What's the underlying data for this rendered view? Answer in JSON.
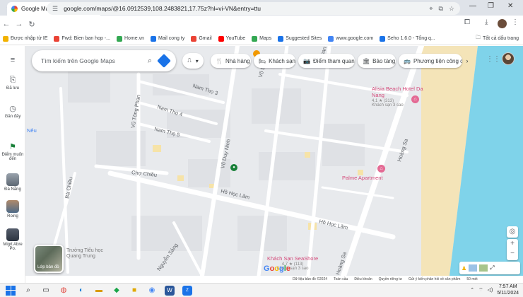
{
  "browser": {
    "tab_title": "Google Maps",
    "url": "google.com/maps/@16.0912539,108.2483821,17.75z?hl=vi-VN&entry=ttu",
    "bookmarks": [
      {
        "label": "Được nhập từ IE",
        "color": "#f2b200"
      },
      {
        "label": "Fwd: Bien ban hop -...",
        "color": "#ea4335"
      },
      {
        "label": "Home.vn",
        "color": "#34a853"
      },
      {
        "label": "Mail cong ty",
        "color": "#1a73e8"
      },
      {
        "label": "Gmail",
        "color": "#ea4335"
      },
      {
        "label": "YouTube",
        "color": "#ff0000"
      },
      {
        "label": "Maps",
        "color": "#34a853"
      },
      {
        "label": "Suggested Sites",
        "color": "#1a73e8"
      },
      {
        "label": "www.google.com",
        "color": "#4285f4"
      },
      {
        "label": "Seho 1.6.0 - Tổng q...",
        "color": "#1a73e8"
      }
    ],
    "all_bookmarks": "Tất cả dấu trang"
  },
  "rail": {
    "saved": "Đã lưu",
    "recent": "Gần đây",
    "want_to_go": "Điểm muốn đến",
    "place1": "Đà Nẵng",
    "place2": "Roing",
    "place3": "Migrt Abre Po."
  },
  "search": {
    "placeholder": "Tìm kiếm trên Google Maps"
  },
  "chips": [
    {
      "icon": "🍴",
      "label": "Nhà hàng"
    },
    {
      "icon": "🛏",
      "label": "Khách sạn"
    },
    {
      "icon": "📷",
      "label": "Điểm tham quan"
    },
    {
      "icon": "🏛",
      "label": "Bảo tàng"
    },
    {
      "icon": "🚌",
      "label": "Phương tiện công cộng"
    }
  ],
  "map": {
    "streets": {
      "nam_tho_3": "Nam Thọ 3",
      "nam_tho_4": "Nam Thọ 4",
      "nam_tho_5": "Nam Thọ 5",
      "vu_tong_phan": "Vũ Tông Phan",
      "vo_duy_ninh": "Võ Duy Ninh",
      "cho_chieu": "Chợ Chiều",
      "ho_hoc_lam": "Hồ Học Lãm",
      "ho_hoc_lam_2": "Hồ Học Lãm",
      "hoang_sa": "Hoàng Sa",
      "hoang_sa_2": "Hoàng Sa",
      "nguyen_sang": "Nguyễn Sáng",
      "phan": "Phan",
      "neu": "Nêu",
      "ba_chieu": "Bà Chiều",
      "vo_duy": "Võ Duy"
    },
    "pois": {
      "alisia_name": "Alisia Beach Hotel Da Nang",
      "alisia_rating": "4.1 ★ (313)",
      "alisia_sub": "Khách sạn 3 sao",
      "palme": "Palme Apartment",
      "seashore_name": "Khách Sạn SeaShore",
      "seashore_rating": "4.7 ★ (113)",
      "seashore_sub": "Khách sạn 3 sao",
      "school": "Trường Tiểu học Quang Trung"
    },
    "layers_label": "Lớp bản đồ",
    "scale": "50 mét",
    "attribution": [
      "Dữ liệu bản đồ ©2024",
      "Toàn cầu",
      "Điều khoản",
      "Quyền riêng tư",
      "Gửi ý kiến phản hồi về sản phẩm"
    ]
  },
  "taskbar": {
    "time": "7:57 AM",
    "date": "5/11/2024"
  }
}
